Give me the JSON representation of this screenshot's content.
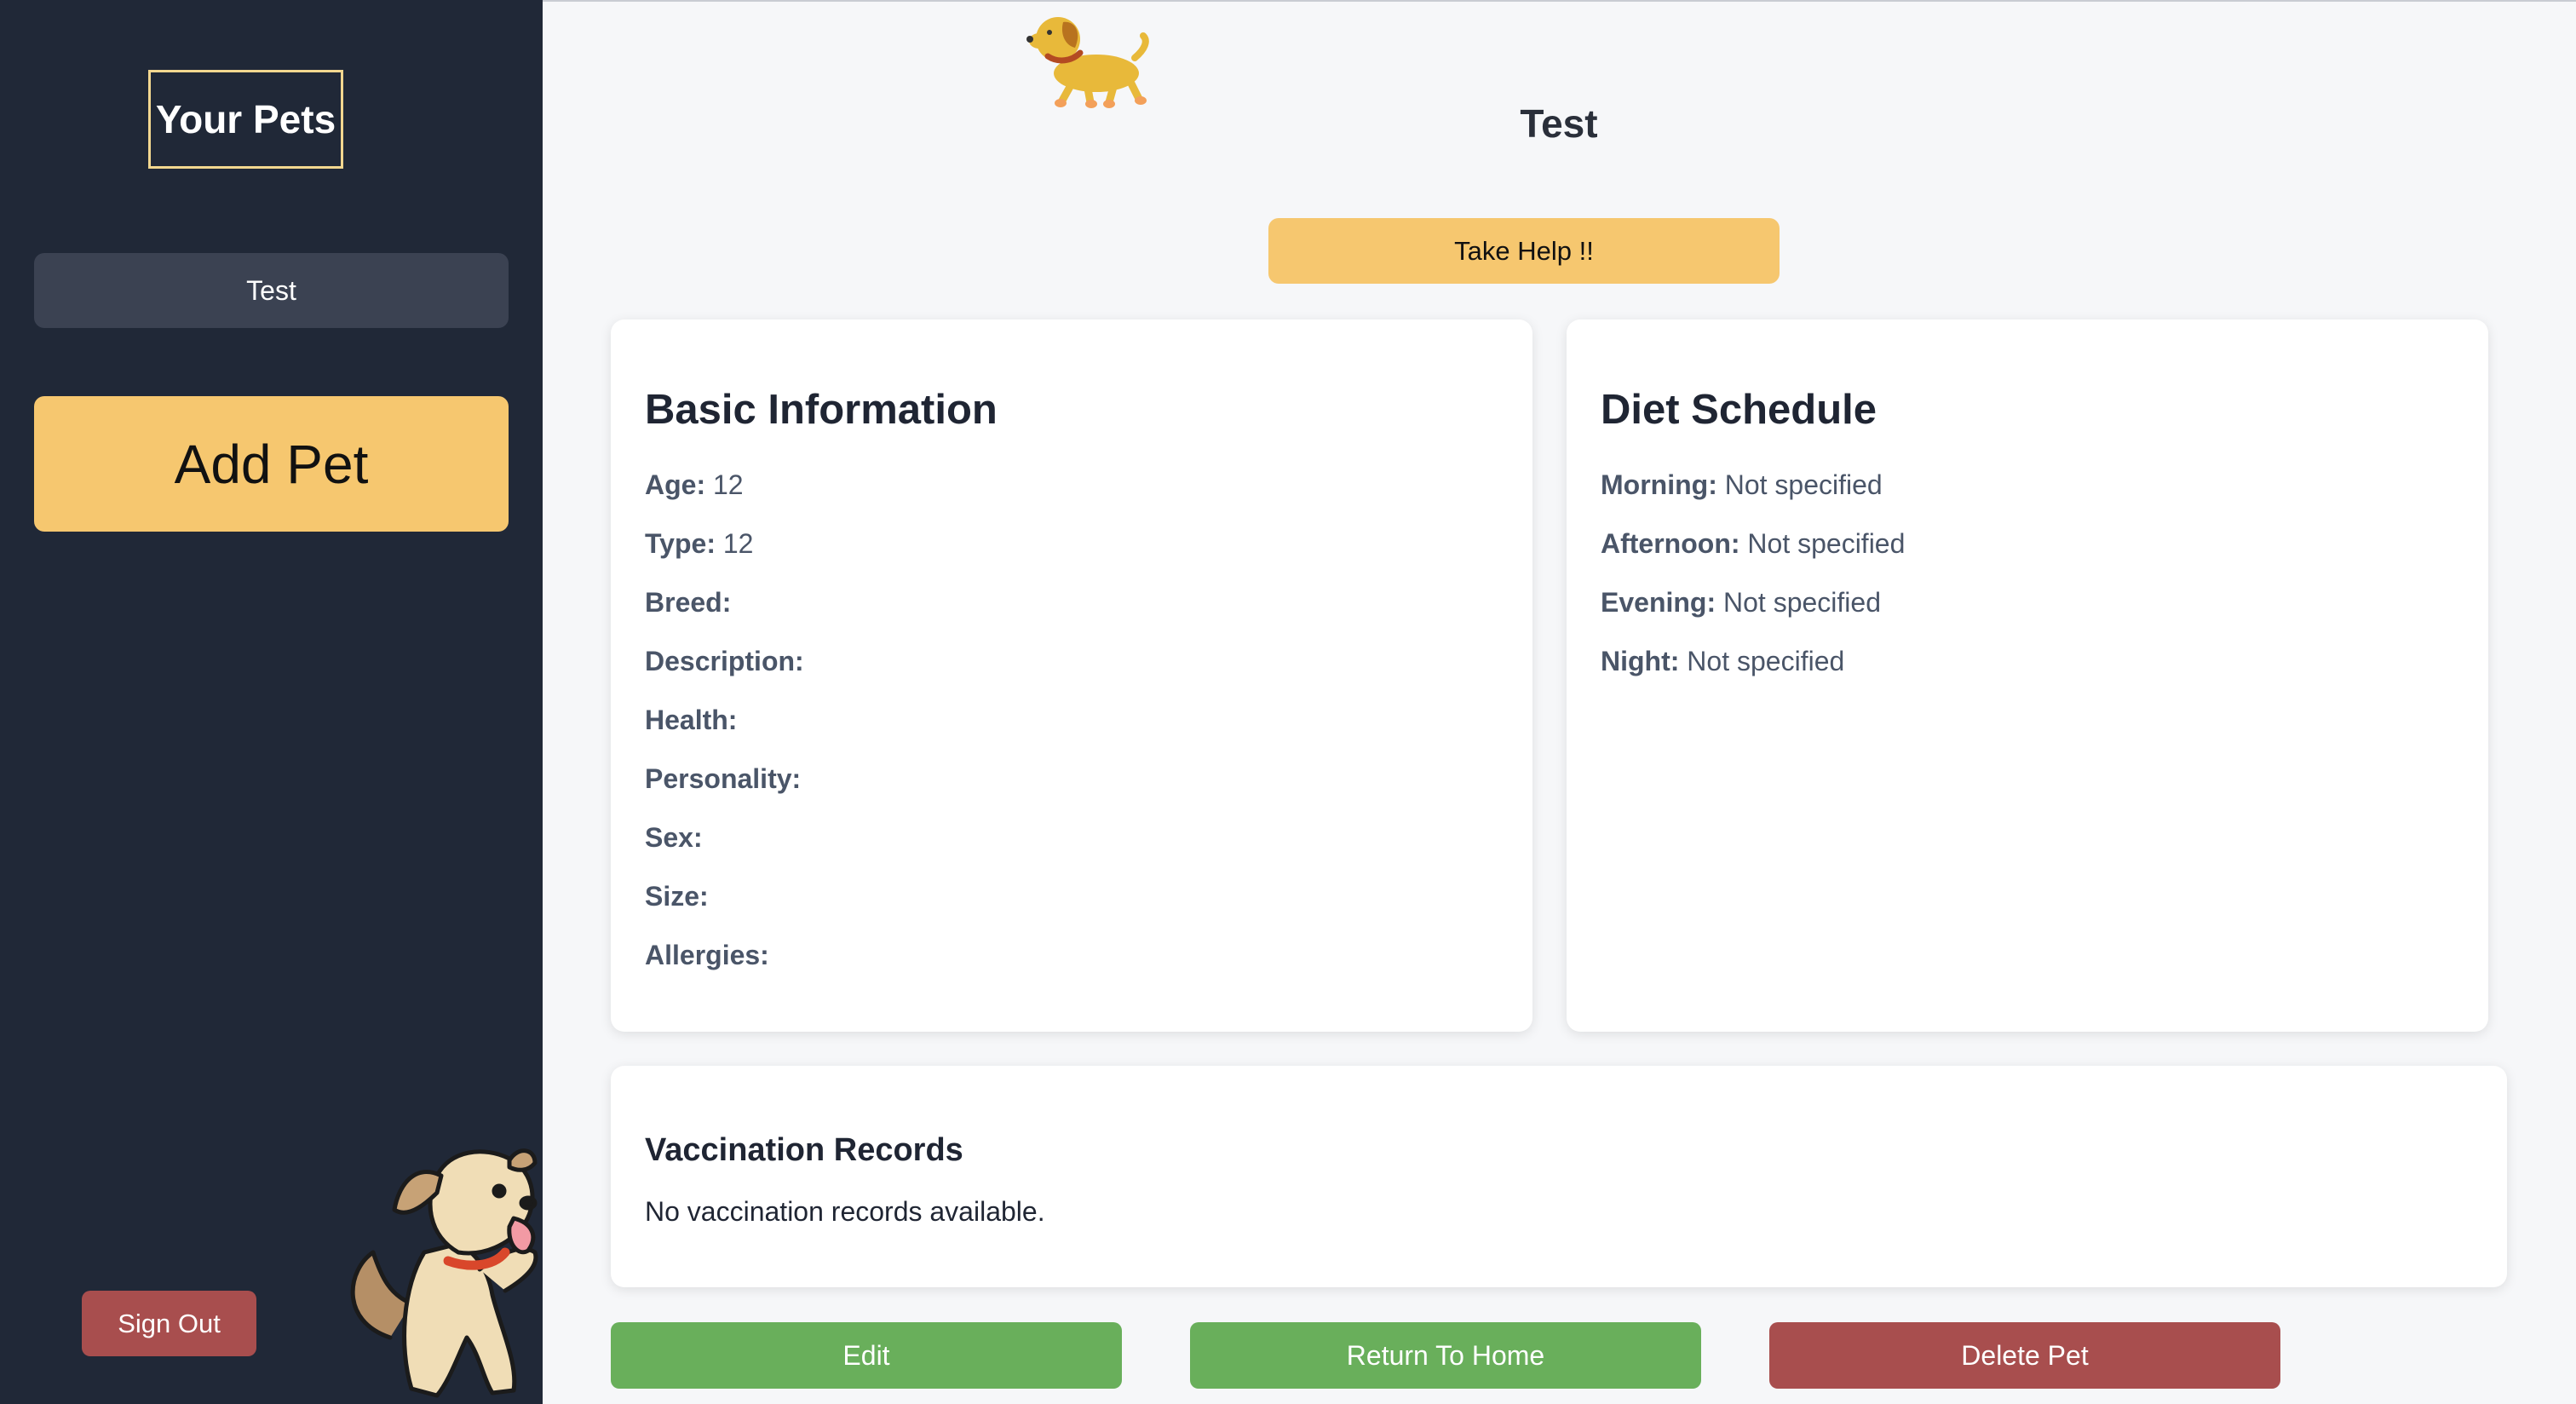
{
  "sidebar": {
    "title": "Your Pets",
    "pets": [
      "Test"
    ],
    "add_label": "Add Pet",
    "signout_label": "Sign Out"
  },
  "main": {
    "pet_name": "Test",
    "help_label": "Take Help !!",
    "basic": {
      "heading": "Basic Information",
      "fields": [
        {
          "label": "Age:",
          "value": "12"
        },
        {
          "label": "Type:",
          "value": "12"
        },
        {
          "label": "Breed:",
          "value": ""
        },
        {
          "label": "Description:",
          "value": ""
        },
        {
          "label": "Health:",
          "value": ""
        },
        {
          "label": "Personality:",
          "value": ""
        },
        {
          "label": "Sex:",
          "value": ""
        },
        {
          "label": "Size:",
          "value": ""
        },
        {
          "label": "Allergies:",
          "value": ""
        }
      ]
    },
    "diet": {
      "heading": "Diet Schedule",
      "fields": [
        {
          "label": "Morning:",
          "value": "Not specified"
        },
        {
          "label": "Afternoon:",
          "value": "Not specified"
        },
        {
          "label": "Evening:",
          "value": "Not specified"
        },
        {
          "label": "Night:",
          "value": "Not specified"
        }
      ]
    },
    "vaccination": {
      "heading": "Vaccination Records",
      "empty_text": "No vaccination records available."
    },
    "actions": {
      "edit": "Edit",
      "home": "Return To Home",
      "delete": "Delete Pet"
    }
  },
  "colors": {
    "sidebar_bg": "#202837",
    "accent_yellow": "#f6c76f",
    "green": "#69af5b",
    "red": "#a84e4e"
  }
}
